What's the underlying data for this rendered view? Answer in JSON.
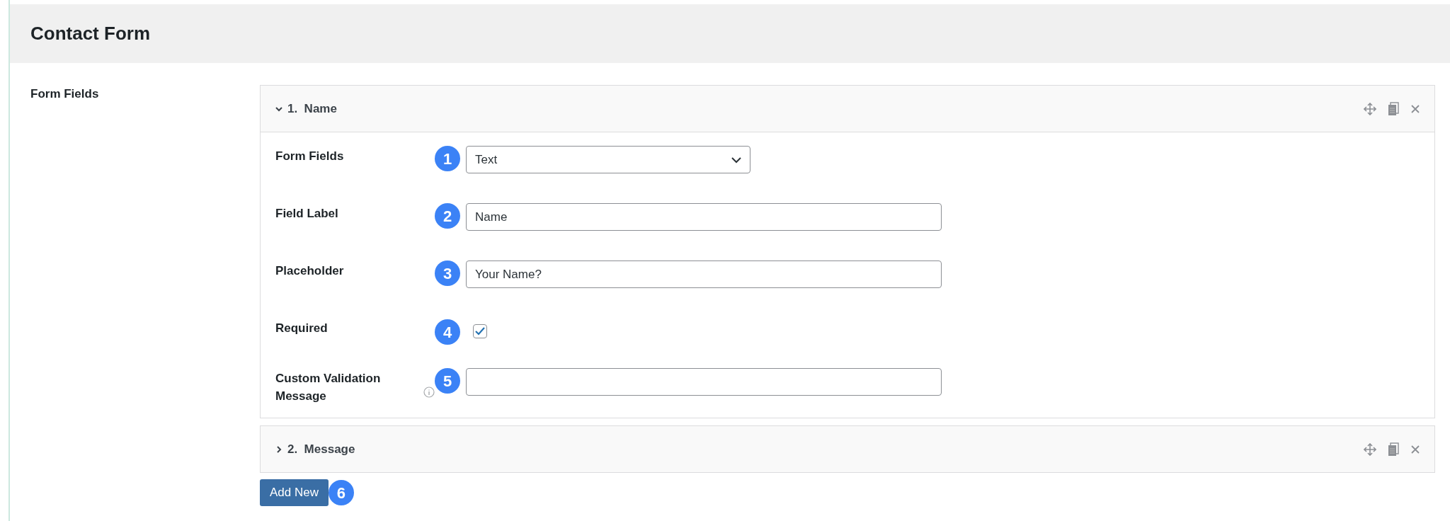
{
  "page": {
    "title": "Contact Form"
  },
  "setting": {
    "label": "Form Fields"
  },
  "panels": [
    {
      "number": "1.",
      "title": "Name",
      "expanded": true,
      "fields": [
        {
          "kind": "select",
          "label": "Form Fields",
          "badge": "1",
          "value": "Text"
        },
        {
          "kind": "text",
          "label": "Field Label",
          "badge": "2",
          "value": "Name"
        },
        {
          "kind": "text",
          "label": "Placeholder",
          "badge": "3",
          "value": "Your Name?"
        },
        {
          "kind": "checkbox",
          "label": "Required",
          "badge": "4",
          "checked": true
        },
        {
          "kind": "text",
          "label": "Custom Validation Message",
          "badge": "5",
          "info": true
        }
      ]
    },
    {
      "number": "2.",
      "title": "Message",
      "expanded": false
    }
  ],
  "add_button": {
    "label": "Add New",
    "badge": "6"
  }
}
